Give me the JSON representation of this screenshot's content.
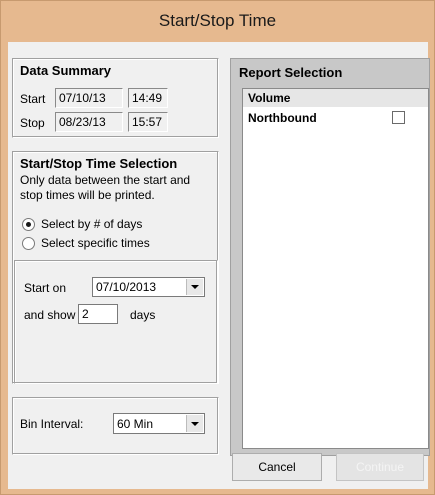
{
  "window": {
    "title": "Start/Stop Time"
  },
  "summary": {
    "title": "Data Summary",
    "start_label": "Start",
    "start_date": "07/10/13",
    "start_time": "14:49",
    "stop_label": "Stop",
    "stop_date": "08/23/13",
    "stop_time": "15:57"
  },
  "selection": {
    "title": "Start/Stop Time Selection",
    "note": "Only data between the start and stop times will be printed.",
    "radio_days": "Select by # of days",
    "radio_specific": "Select specific times",
    "selected": "days",
    "start_on_label": "Start on",
    "start_on_value": "07/10/2013",
    "show_label": "and show",
    "show_value": "2",
    "days_label": "days"
  },
  "bin": {
    "label": "Bin Interval:",
    "value": "60 Min"
  },
  "report": {
    "title": "Report Selection",
    "header": "Volume",
    "items": [
      {
        "label": "Northbound",
        "checked": false
      }
    ]
  },
  "buttons": {
    "cancel": "Cancel",
    "continue": "Continue"
  }
}
